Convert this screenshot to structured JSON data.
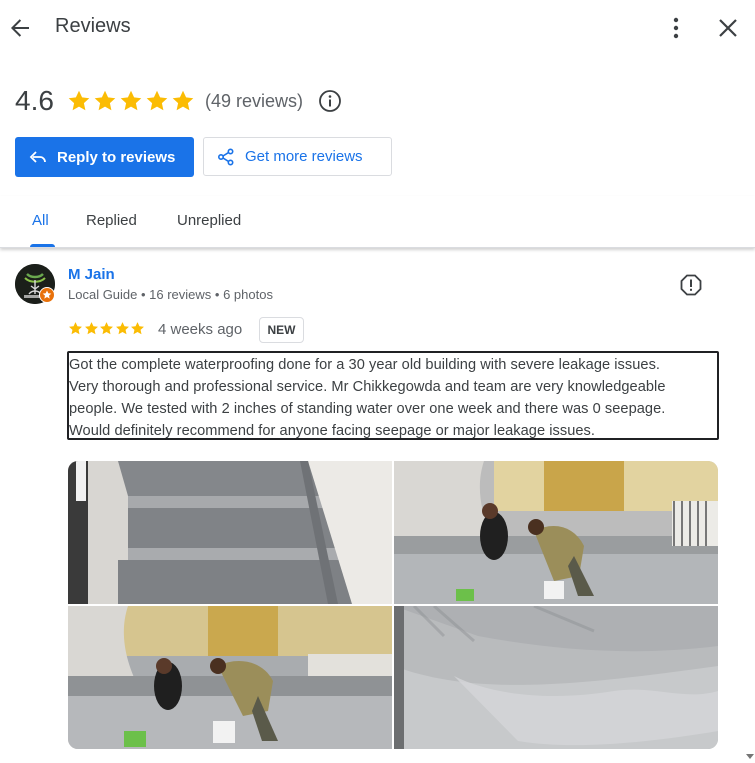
{
  "header": {
    "title": "Reviews"
  },
  "summary": {
    "rating": "4.6",
    "stars": 5,
    "review_count": "(49 reviews)"
  },
  "actions": {
    "reply_label": "Reply to reviews",
    "get_more_label": "Get more reviews"
  },
  "tabs": [
    {
      "label": "All",
      "active": true
    },
    {
      "label": "Replied",
      "active": false
    },
    {
      "label": "Unreplied",
      "active": false
    }
  ],
  "review": {
    "name": "M Jain",
    "meta": "Local Guide • 16 reviews • 6 photos",
    "stars": 5,
    "date": "4 weeks ago",
    "badge": "NEW",
    "text": "Got the complete waterproofing done for a 30 year old building with severe leakage issues.\nVery thorough and professional service. Mr Chikkegowda and team are very knowledgeable\npeople. We tested with 2 inches of standing water over one week and there was 0 seepage.\nWould definitely recommend for anyone facing seepage or major leakage issues.",
    "photo_count": 4
  },
  "colors": {
    "accent": "#1a73e8",
    "star": "#fbbc04",
    "text": "#3c4043",
    "secondary": "#5f6368"
  },
  "icons": {
    "back": "arrow-left-icon",
    "more": "more-vert-icon",
    "close": "close-icon",
    "info": "info-icon",
    "reply": "reply-icon",
    "share": "share-icon",
    "flag": "report-icon"
  }
}
